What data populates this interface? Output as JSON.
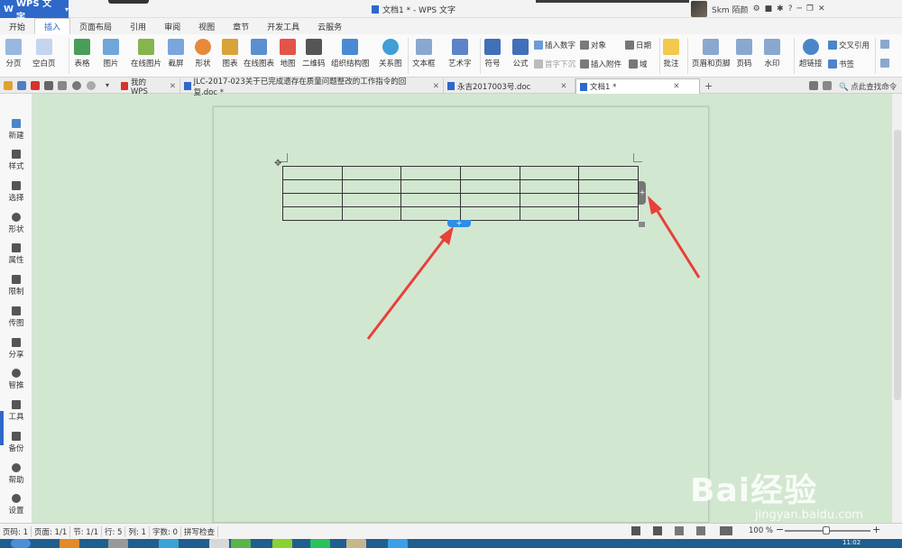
{
  "titlebar": {
    "app_name": "WPS 文字",
    "doc_title": "文档1 * - WPS 文字",
    "user": "Skm 陌颜"
  },
  "menu_tabs": [
    "开始",
    "插入",
    "页面布局",
    "引用",
    "审阅",
    "视图",
    "章节",
    "开发工具",
    "云服务"
  ],
  "active_menu_tab": "插入",
  "ribbon": {
    "big": [
      "分页",
      "空白页",
      "表格",
      "图片",
      "在线图片",
      "截屏",
      "形状",
      "图表",
      "在线图表",
      "地图",
      "二维码",
      "组织结构图",
      "关系图",
      "文本框",
      "艺术字",
      "符号",
      "公式",
      "批注",
      "页眉和页脚",
      "页码",
      "水印",
      "超链接"
    ],
    "small": [
      "插入数字",
      "对象",
      "日期",
      "首字下沉",
      "插入附件",
      "域",
      "交叉引用",
      "书签"
    ]
  },
  "doc_tabs": [
    {
      "label": "我的WPS"
    },
    {
      "label": "JLC-2017-023关于已完成遗存在质量问题整改的工作指令的回复.doc *"
    },
    {
      "label": "永吉2017003号.doc"
    },
    {
      "label": "文档1 *"
    }
  ],
  "search_cmd": "点此查找命令",
  "sidebar": [
    "新建",
    "样式",
    "选择",
    "形状",
    "属性",
    "限制",
    "传图",
    "分享",
    "智推",
    "工具",
    "备份",
    "帮助",
    "设置"
  ],
  "status": {
    "page": "页码: 1",
    "pages": "页面: 1/1",
    "section": "节: 1/1",
    "row": "行: 5",
    "col": "列: 1",
    "words": "字数: 0",
    "spell": "拼写检查",
    "zoom": "100 %",
    "clock": "11:02"
  },
  "table": {
    "rows": 4,
    "cols": 6
  },
  "watermark": {
    "main": "Bai经验",
    "sub": "jingyan.baidu.com"
  },
  "colors": {
    "accent": "#2e68c9",
    "arrow": "#e8403a",
    "page_bg": "#d2e7d0"
  }
}
